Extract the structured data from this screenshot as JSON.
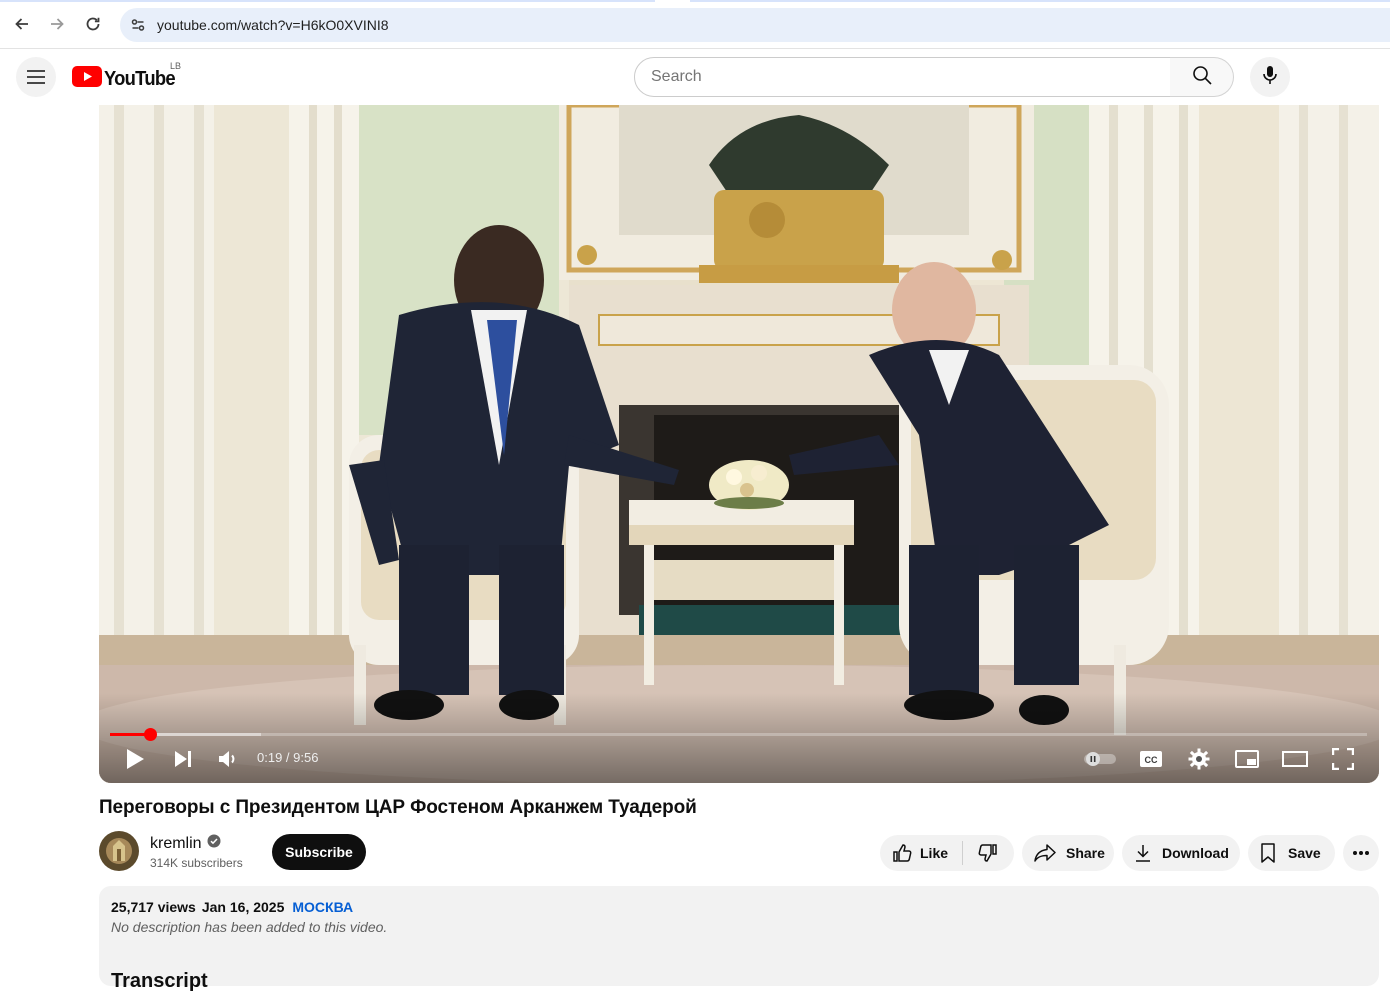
{
  "browser": {
    "url": "youtube.com/watch?v=H6kO0XVINI8",
    "icons": [
      "back-arrow-icon",
      "forward-arrow-icon",
      "reload-icon",
      "site-settings-icon"
    ]
  },
  "header": {
    "logo_text": "YouTube",
    "country_code": "LB",
    "search_placeholder": "Search",
    "icons": [
      "hamburger-menu-icon",
      "youtube-play-logo-icon",
      "search-icon",
      "microphone-icon"
    ]
  },
  "player": {
    "current_time": "0:19",
    "duration": "9:56",
    "time_display": "0:19 / 9:56",
    "progress_fraction": 0.032,
    "buffered_fraction": 0.12,
    "controls": [
      "play-icon",
      "next-icon",
      "volume-icon",
      "autoplay-toggle-icon",
      "captions-icon",
      "settings-gear-icon",
      "miniplayer-icon",
      "theater-mode-icon",
      "fullscreen-icon"
    ]
  },
  "video": {
    "title": "Переговоры с Президентом ЦАР Фостеном Арканжем Туадерой"
  },
  "channel": {
    "name": "kremlin",
    "verified": true,
    "subscribers": "314K subscribers",
    "subscribe_label": "Subscribe"
  },
  "actions": {
    "like_label": "Like",
    "share_label": "Share",
    "download_label": "Download",
    "save_label": "Save"
  },
  "description": {
    "views": "25,717 views",
    "date": "Jan 16, 2025",
    "location_tag": "МОСКВА",
    "text": "No description has been added to this video.",
    "next_section_heading": "Transcript"
  },
  "colors": {
    "accent_red": "#ff0000",
    "link_blue": "#065fd4",
    "chip_bg": "#f2f2f2",
    "subscribe_bg": "#0f0f0f"
  }
}
